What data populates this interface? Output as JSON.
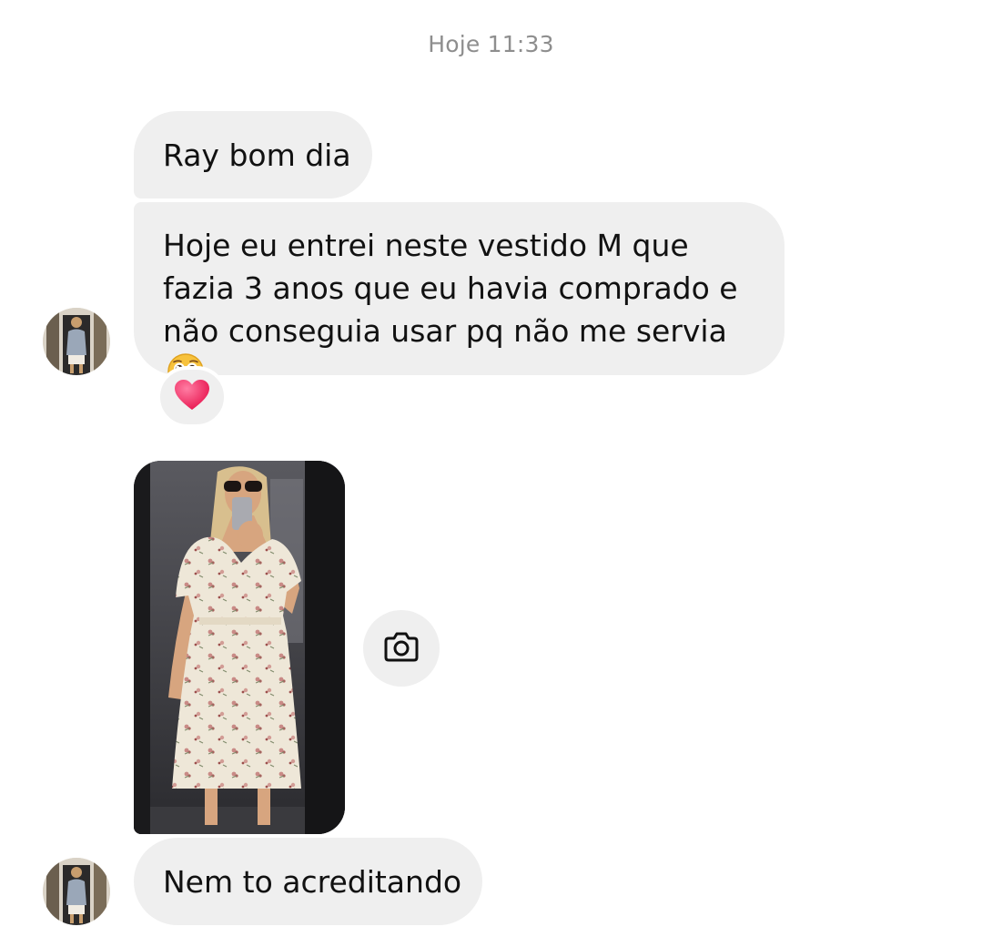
{
  "thread": {
    "timestamp": "Hoje 11:33"
  },
  "messages": [
    {
      "text": "Ray bom dia"
    },
    {
      "text": "Hoje eu entrei neste vestido M que fazia 3 anos que eu havia comprado e não conseguia usar pq não me servia",
      "emoji": "pleading-face-icon",
      "reaction": "red-heart-icon"
    },
    {
      "type": "photo",
      "description_icon": "camera-icon"
    },
    {
      "text": "Nem to acreditando"
    }
  ],
  "colors": {
    "bubble_background": "#efefef",
    "timestamp_text": "#8e8e8e",
    "message_text": "#111111",
    "reaction_heart": "#f0336a"
  }
}
